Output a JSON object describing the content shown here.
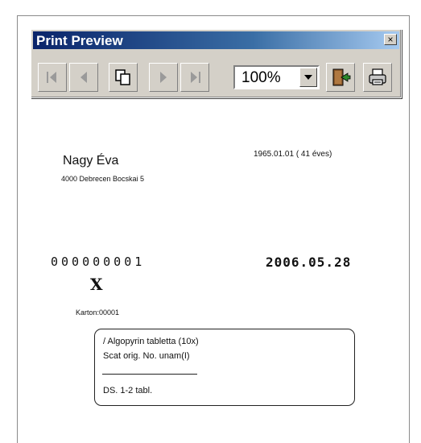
{
  "toolbar": {
    "title": "Print Preview",
    "close_label": "×",
    "zoom_value": "100%",
    "buttons": [
      "first-page",
      "previous-page",
      "multiple-pages",
      "next-page",
      "last-page",
      "close-preview",
      "print"
    ]
  },
  "document": {
    "patient_name": "Nagy Éva",
    "patient_address": "4000 Debrecen Bocskai 5",
    "birth_date": "1965.01.01 ( 41 éves)",
    "id_number": "000000001",
    "issue_date": "2006.05.28",
    "mark": "X",
    "karton": "Karton:00001",
    "prescription": {
      "line1": "/ Algopyrin tabletta (10x)",
      "line2": "Scat orig. No. unam(I)",
      "dosage": "DS. 1-2 tabl."
    }
  }
}
